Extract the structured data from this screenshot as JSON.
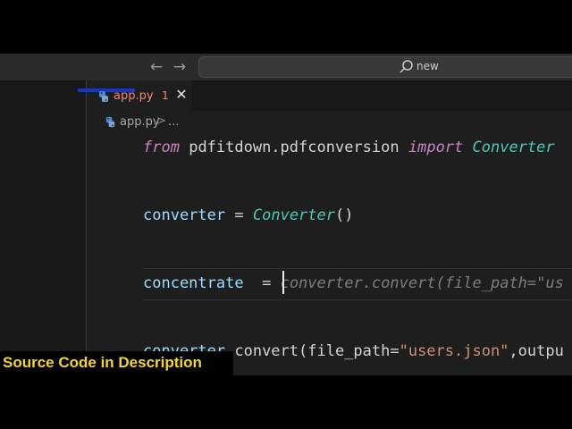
{
  "titlebar": {
    "back_icon": "arrow-left-icon",
    "forward_icon": "arrow-right-icon",
    "search_icon": "search-icon",
    "search_label": "new"
  },
  "tab": {
    "filename": "app.py",
    "problem_count": "1",
    "close_icon": "close-icon",
    "close_glyph": "✕",
    "label_color": "#f48771"
  },
  "breadcrumb": {
    "file": "app.py",
    "separator": ">",
    "more": "..."
  },
  "code": {
    "line1": {
      "kw_from": "from",
      "module": "pdfitdown.pdfconversion",
      "kw_import": "import",
      "cls": "Converter"
    },
    "line2": {
      "var": "converter",
      "op": "=",
      "cls": "Converter",
      "call": "()"
    },
    "line3": {
      "var": "concentrate",
      "op": "=",
      "suggestion": "converter.convert(file_path=\"us"
    },
    "line4": {
      "var": "converter",
      "rest": ".convert(file_path=",
      "str": "\"users.json\"",
      "tail": ",outpu"
    }
  },
  "caption": {
    "text": "Source Code in  Description",
    "color": "#f5d33c"
  }
}
